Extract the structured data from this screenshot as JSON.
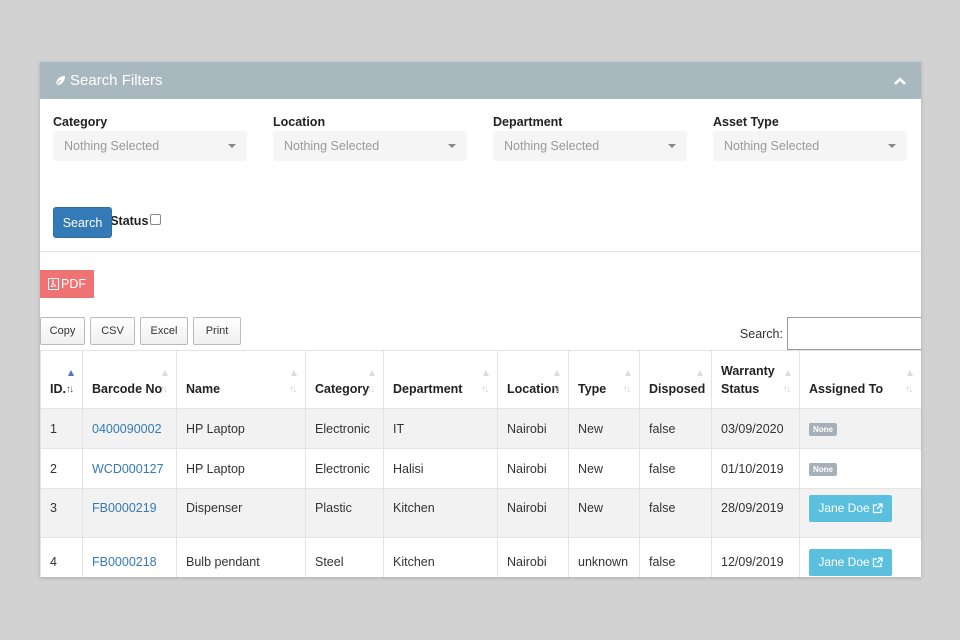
{
  "panel": {
    "title": "Search Filters",
    "header_color": "#a9b8bf"
  },
  "filters": {
    "category": {
      "label": "Category",
      "value": "Nothing Selected"
    },
    "location": {
      "label": "Location",
      "value": "Nothing Selected"
    },
    "department": {
      "label": "Department",
      "value": "Nothing Selected"
    },
    "asset_type": {
      "label": "Asset Type",
      "value": "Nothing Selected"
    },
    "warranty_status": {
      "label": "Warranty Status",
      "checked": false
    },
    "search_label": "Search"
  },
  "export": {
    "pdf_label": "PDF",
    "copy_label": "Copy",
    "csv_label": "CSV",
    "excel_label": "Excel",
    "print_label": "Print"
  },
  "table_search": {
    "label": "Search:",
    "value": ""
  },
  "table": {
    "columns": [
      "ID.",
      "Barcode No",
      "Name",
      "Category",
      "Department",
      "Location",
      "Type",
      "Disposed",
      "Warranty Status",
      "Assigned To"
    ],
    "sorted_column": "ID.",
    "rows": [
      {
        "id": "1",
        "barcode": "0400090002",
        "name": "HP Laptop",
        "category": "Electronic",
        "department": "IT",
        "location": "Nairobi",
        "type": "New",
        "disposed": "false",
        "warranty": "03/09/2020",
        "assigned": "None"
      },
      {
        "id": "2",
        "barcode": "WCD000127",
        "name": "HP Laptop",
        "category": "Electronic",
        "department": "Halisi",
        "location": "Nairobi",
        "type": "New",
        "disposed": "false",
        "warranty": "01/10/2019",
        "assigned": "None"
      },
      {
        "id": "3",
        "barcode": "FB0000219",
        "name": "Dispenser",
        "category": "Plastic",
        "department": "Kitchen",
        "location": "Nairobi",
        "type": "New",
        "disposed": "false",
        "warranty": "28/09/2019",
        "assigned": "Jane Doe"
      },
      {
        "id": "4",
        "barcode": "FB0000218",
        "name": "Bulb pendant",
        "category": "Steel",
        "department": "Kitchen",
        "location": "Nairobi",
        "type": "unknown",
        "disposed": "false",
        "warranty": "12/09/2019",
        "assigned": "Jane Doe"
      }
    ]
  },
  "colors": {
    "primary": "#337ab7",
    "pdf": "#f07373",
    "info": "#5bc0de",
    "badge_none": "#a6b0b8"
  }
}
